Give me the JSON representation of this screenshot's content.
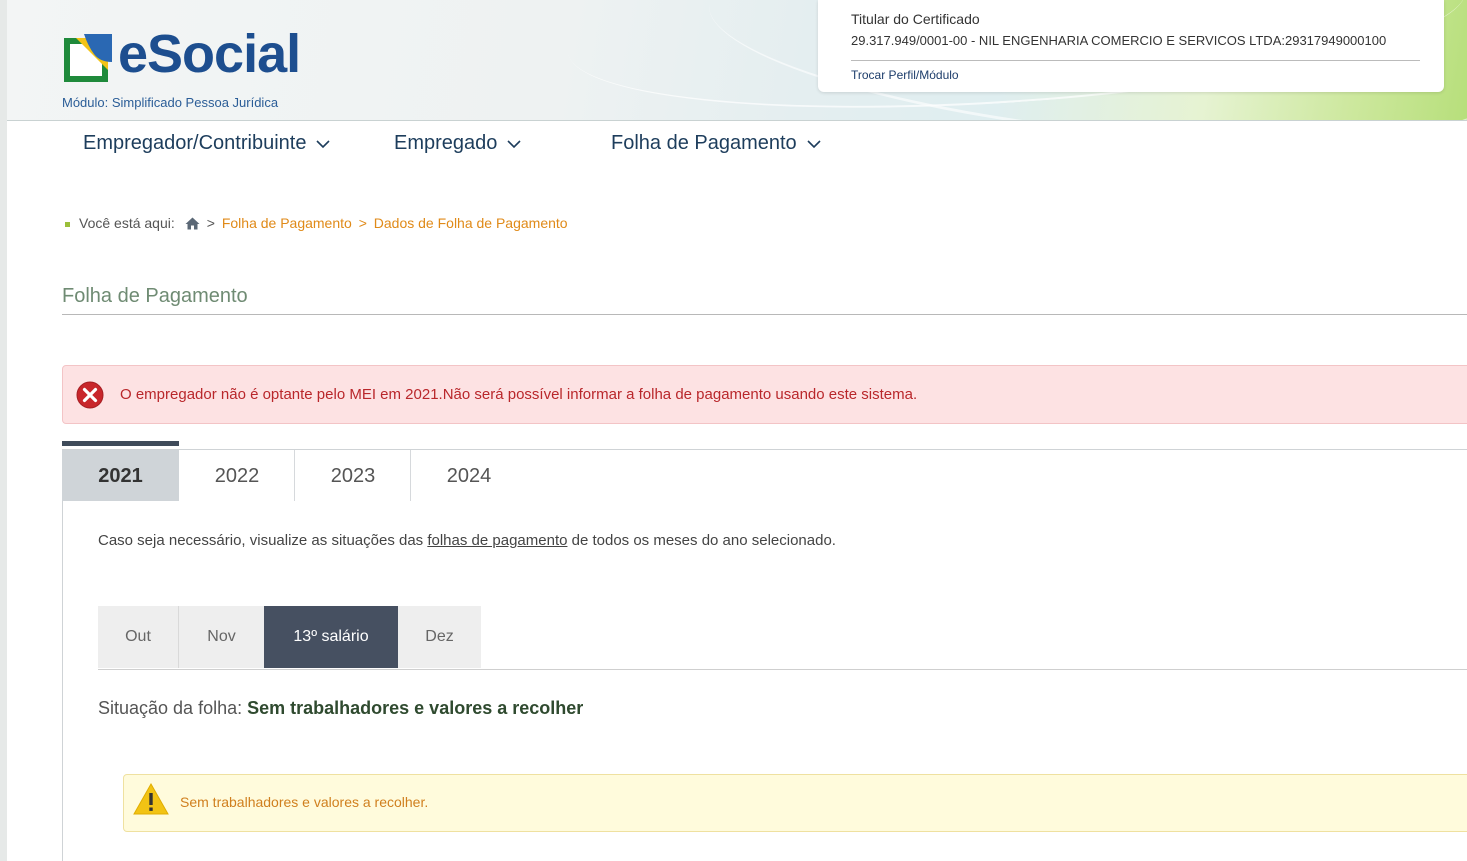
{
  "header": {
    "logo_text": "eSocial",
    "module_label": "Módulo: Simplificado Pessoa Jurídica",
    "certificate": {
      "title": "Titular do Certificado",
      "value": "29.317.949/0001-00 - NIL ENGENHARIA COMERCIO E SERVICOS LTDA:29317949000100",
      "switch_link": "Trocar Perfil/Módulo"
    }
  },
  "nav": {
    "items": [
      {
        "label": "Empregador/Contribuinte"
      },
      {
        "label": "Empregado"
      },
      {
        "label": "Folha de Pagamento"
      }
    ]
  },
  "breadcrumb": {
    "prefix": "Você está aqui:",
    "separator": ">",
    "items": [
      "Folha de Pagamento",
      "Dados de Folha de Pagamento"
    ]
  },
  "page": {
    "title": "Folha de Pagamento"
  },
  "alerts": {
    "error": "O empregador não é optante pelo MEI em 2021.Não será possível informar a folha de pagamento usando este sistema.",
    "warning": "Sem trabalhadores e valores a recolher."
  },
  "year_tabs": {
    "items": [
      "2021",
      "2022",
      "2023",
      "2024"
    ],
    "active": "2021"
  },
  "info": {
    "before": "Caso seja necessário, visualize as situações das ",
    "link": "folhas de pagamento",
    "after": " de todos os meses do ano selecionado."
  },
  "month_tabs": {
    "items": [
      "Out",
      "Nov",
      "13º salário",
      "Dez"
    ],
    "active": "13º salário"
  },
  "status": {
    "label": "Situação da folha: ",
    "value": "Sem trabalhadores e valores a recolher"
  },
  "colors": {
    "accent_navy": "#1d3d5c",
    "logo_blue": "#1d4e8f",
    "breadcrumb_link": "#e08a18",
    "error_text": "#b9272b",
    "warning_text": "#d07f1e",
    "active_tab": "#465061"
  }
}
